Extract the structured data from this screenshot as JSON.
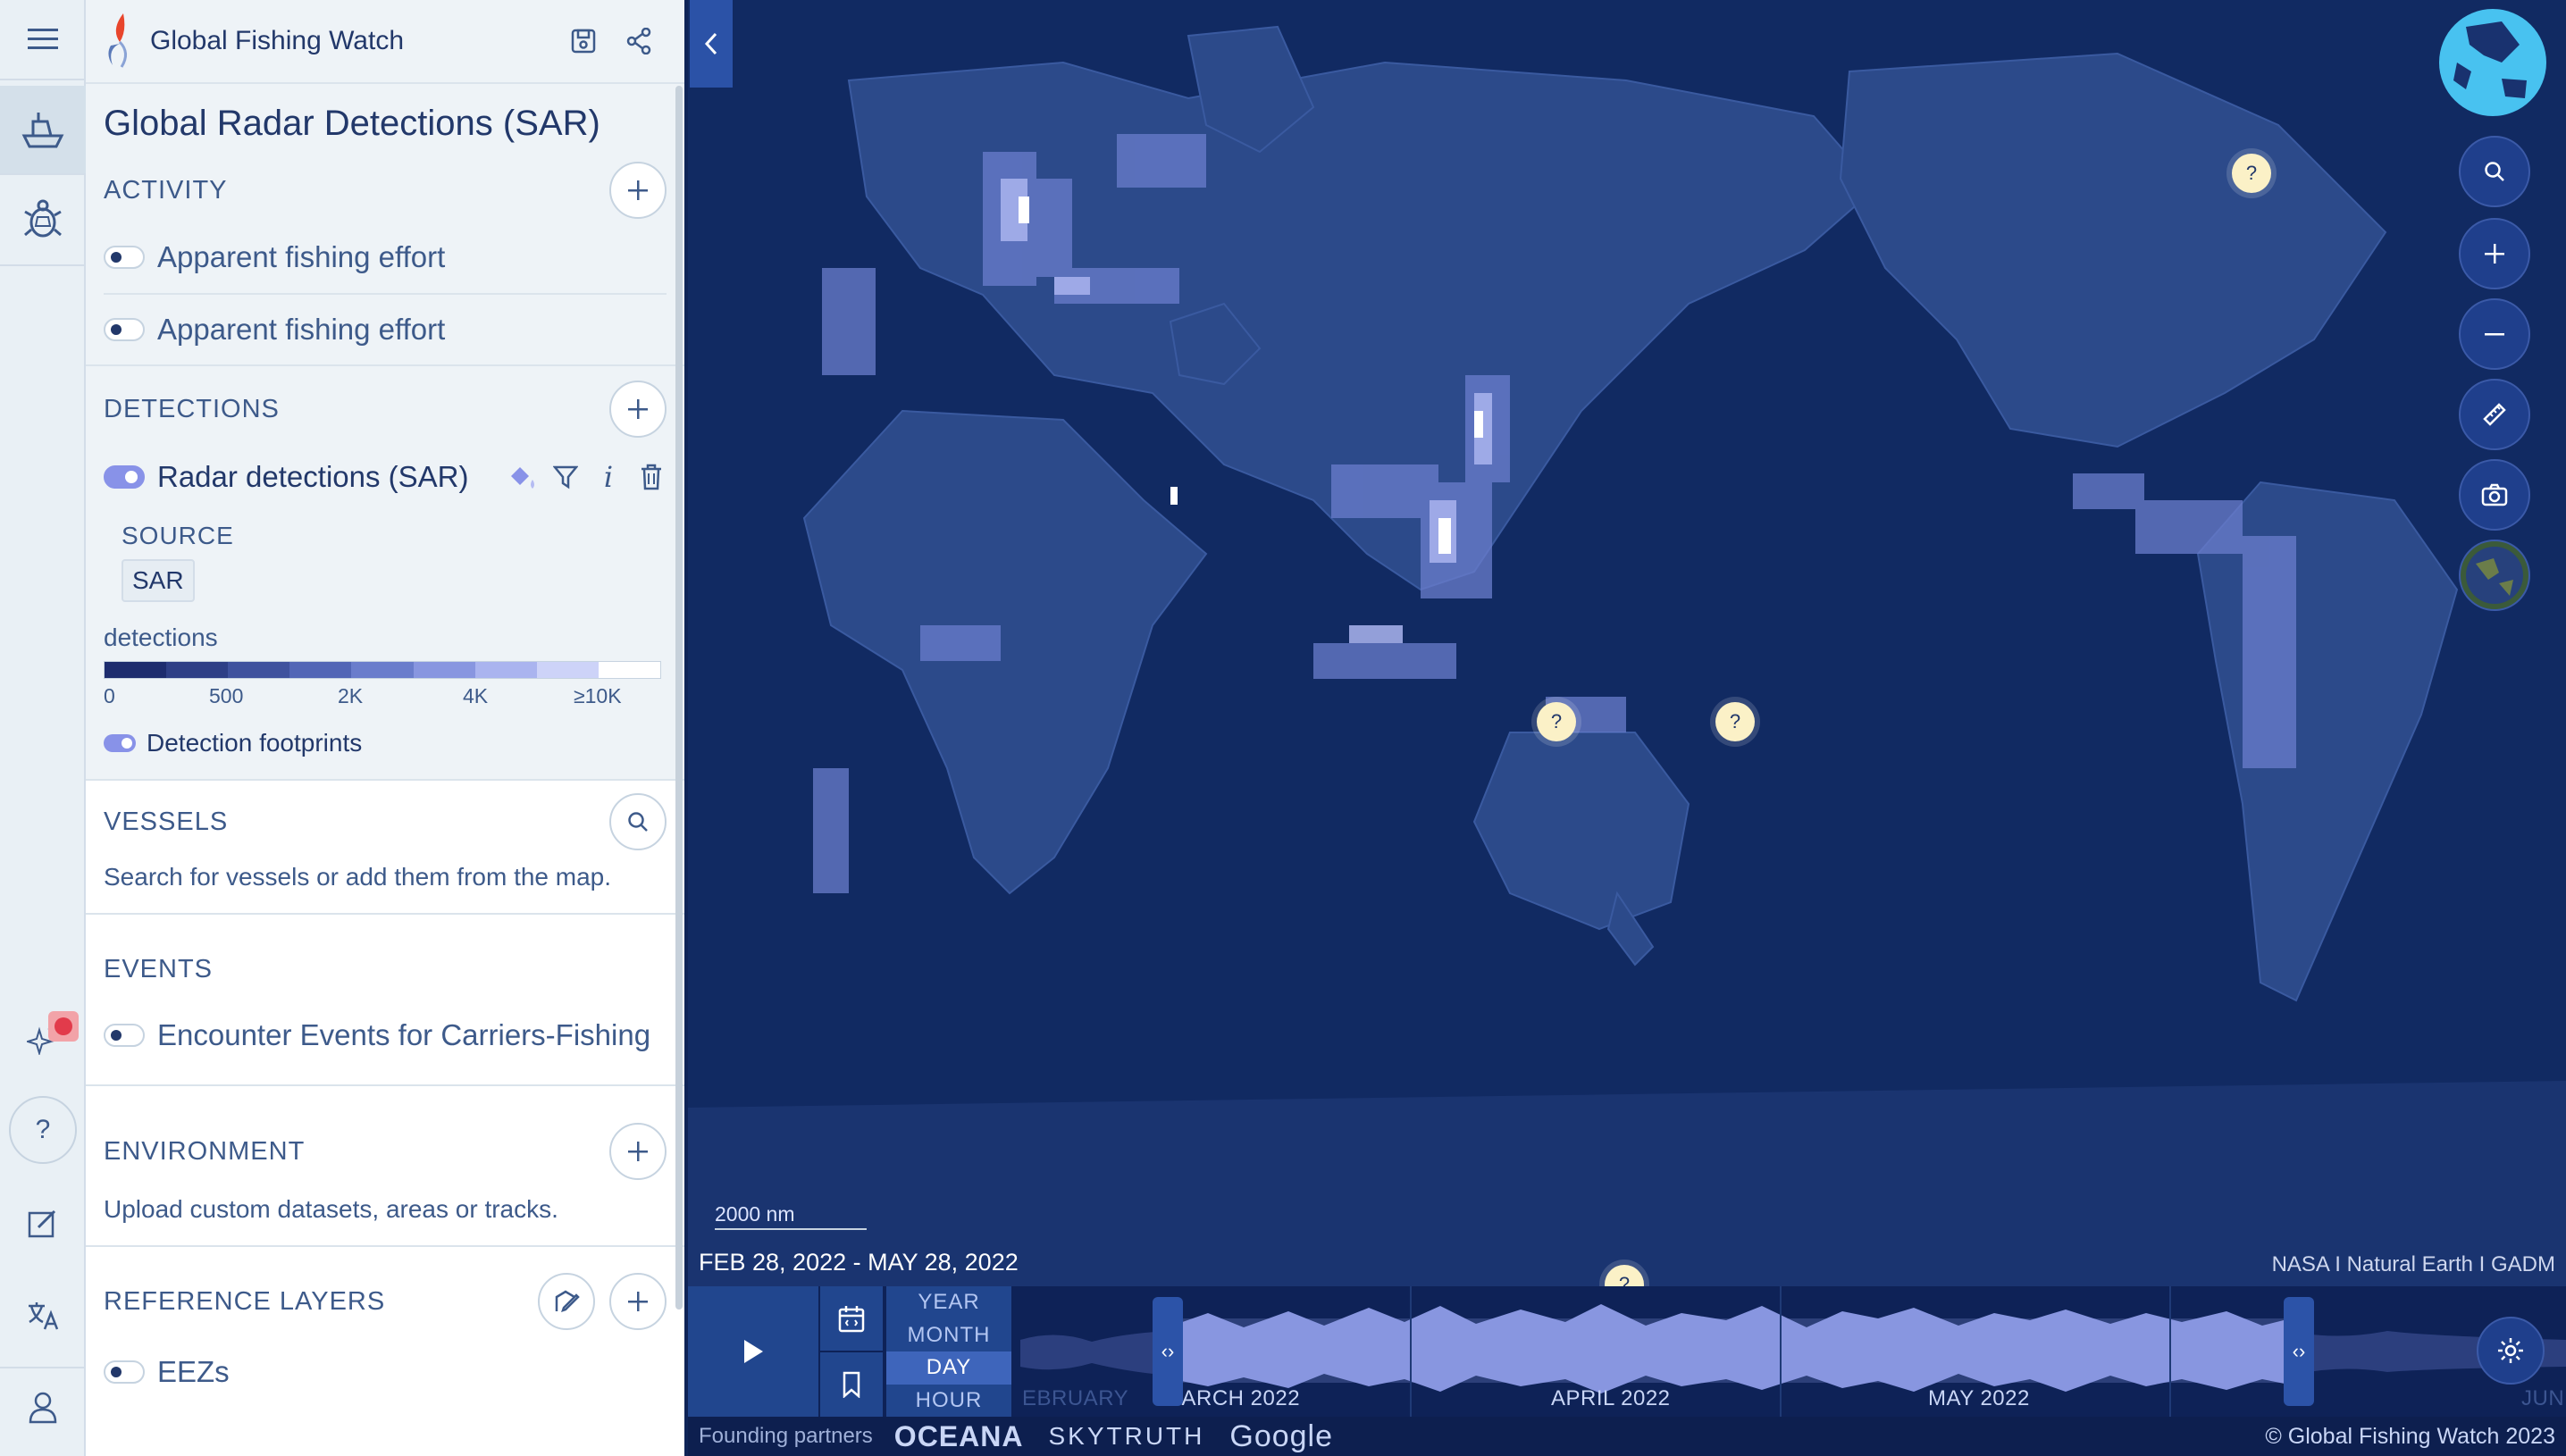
{
  "app": {
    "title": "Global Fishing Watch"
  },
  "workspace": {
    "title": "Global Radar Detections (SAR)"
  },
  "sections": {
    "activity": {
      "title": "ACTIVITY",
      "layers": [
        {
          "label": "Apparent fishing effort",
          "enabled": false
        },
        {
          "label": "Apparent fishing effort",
          "enabled": false
        }
      ]
    },
    "detections": {
      "title": "DETECTIONS",
      "layer": {
        "label": "Radar detections (SAR)",
        "enabled": true
      },
      "source_label": "SOURCE",
      "source_chip": "SAR",
      "legend_label": "detections",
      "legend_ticks": [
        "0",
        "500",
        "2K",
        "4K",
        "≥10K"
      ],
      "legend_colors": [
        "#1d2c6e",
        "#2e3f86",
        "#3f529e",
        "#5266b6",
        "#6a7dcc",
        "#8896e0",
        "#aab4ef",
        "#cdd3f8",
        "#ffffff"
      ],
      "footprints_label": "Detection footprints"
    },
    "vessels": {
      "title": "VESSELS",
      "note": "Search for vessels or add them from the map."
    },
    "events": {
      "title": "EVENTS",
      "layer": {
        "label": "Encounter Events for Carriers-Fishing",
        "enabled": false
      }
    },
    "environment": {
      "title": "ENVIRONMENT",
      "note": "Upload custom datasets, areas or tracks."
    },
    "reference": {
      "title": "REFERENCE LAYERS",
      "layer": {
        "label": "EEZs",
        "enabled": false
      }
    }
  },
  "map": {
    "help_pin": "?",
    "scale_label": "2000 nm",
    "date_range": "FEB 28, 2022 - MAY 28, 2022",
    "attribution": "NASA I Natural Earth I GADM",
    "colors": {
      "ocean": "#112a62",
      "land": "#2c4a8a",
      "detection": "#8896e0"
    }
  },
  "timebar": {
    "resolutions": [
      "YEAR",
      "MONTH",
      "DAY",
      "HOUR"
    ],
    "selected_resolution": "DAY",
    "months": [
      "EBRUARY",
      "MARCH 2022",
      "APRIL 2022",
      "MAY 2022",
      "JUN"
    ],
    "handle_glyph": "‹›"
  },
  "footer": {
    "partners_label": "Founding partners",
    "partners": [
      "OCEANA",
      "SKYTRUTH",
      "Google"
    ],
    "copyright": "© Global Fishing Watch 2023"
  }
}
